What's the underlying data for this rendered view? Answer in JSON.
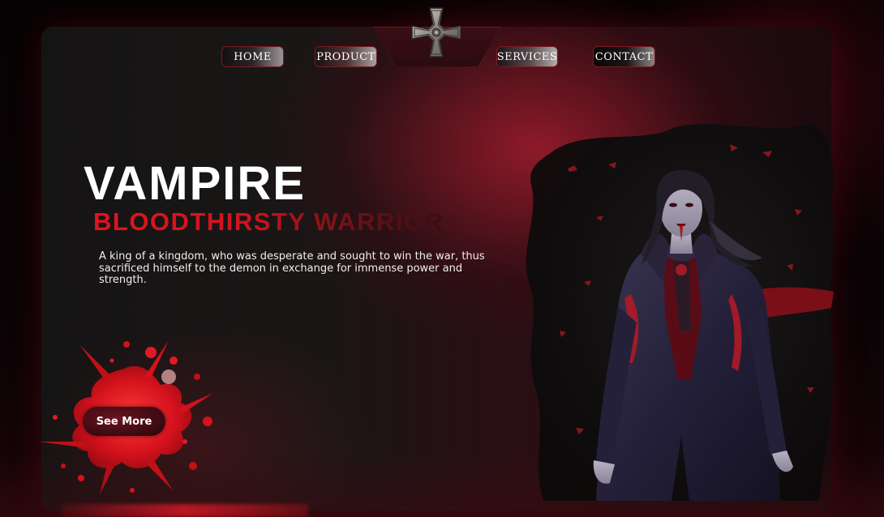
{
  "nav": {
    "items": [
      {
        "label": "HOME"
      },
      {
        "label": "PRODUCT"
      },
      {
        "label": "SERVICES"
      },
      {
        "label": "CONTACT"
      }
    ],
    "emblem_icon": "iron-cross-icon"
  },
  "hero": {
    "title": "VAMPIRE",
    "subtitle": "BLOODTHIRSTY WARRIOR",
    "description": "A king of a kingdom, who was desperate and sought to win the war, thus sacrificed himself to the demon in exchange for immense power and strength.",
    "cta_label": "See More",
    "cta_decoration": "blood-splatter"
  },
  "illustration": "vampire-character",
  "colors": {
    "accent": "#d0131d",
    "background": "#151414",
    "glow": "#a01c2d"
  }
}
